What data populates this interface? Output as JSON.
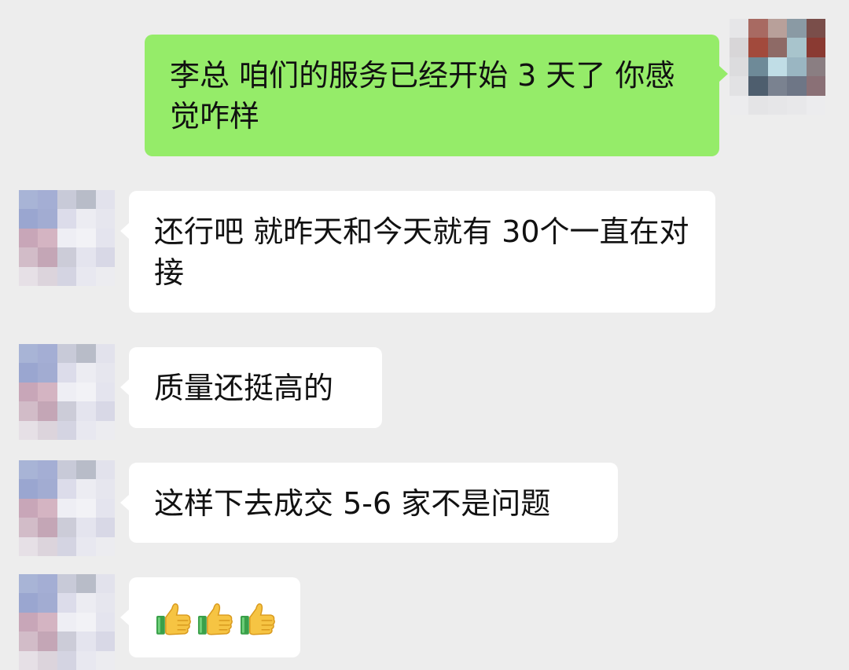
{
  "messages": [
    {
      "side": "out",
      "text": "李总 咱们的服务已经开始 3 天了 你感觉咋样"
    },
    {
      "side": "in",
      "text": "还行吧 就昨天和今天就有 30个一直在对接"
    },
    {
      "side": "in",
      "text": "质量还挺高的"
    },
    {
      "side": "in",
      "text": "这样下去成交 5-6 家不是问题"
    },
    {
      "side": "in",
      "emoji": [
        "thumbs-up-icon",
        "thumbs-up-icon",
        "thumbs-up-icon"
      ]
    }
  ],
  "colors": {
    "background": "#ededed",
    "outgoing_bubble": "#95ec69",
    "incoming_bubble": "#ffffff",
    "text": "#111111"
  }
}
